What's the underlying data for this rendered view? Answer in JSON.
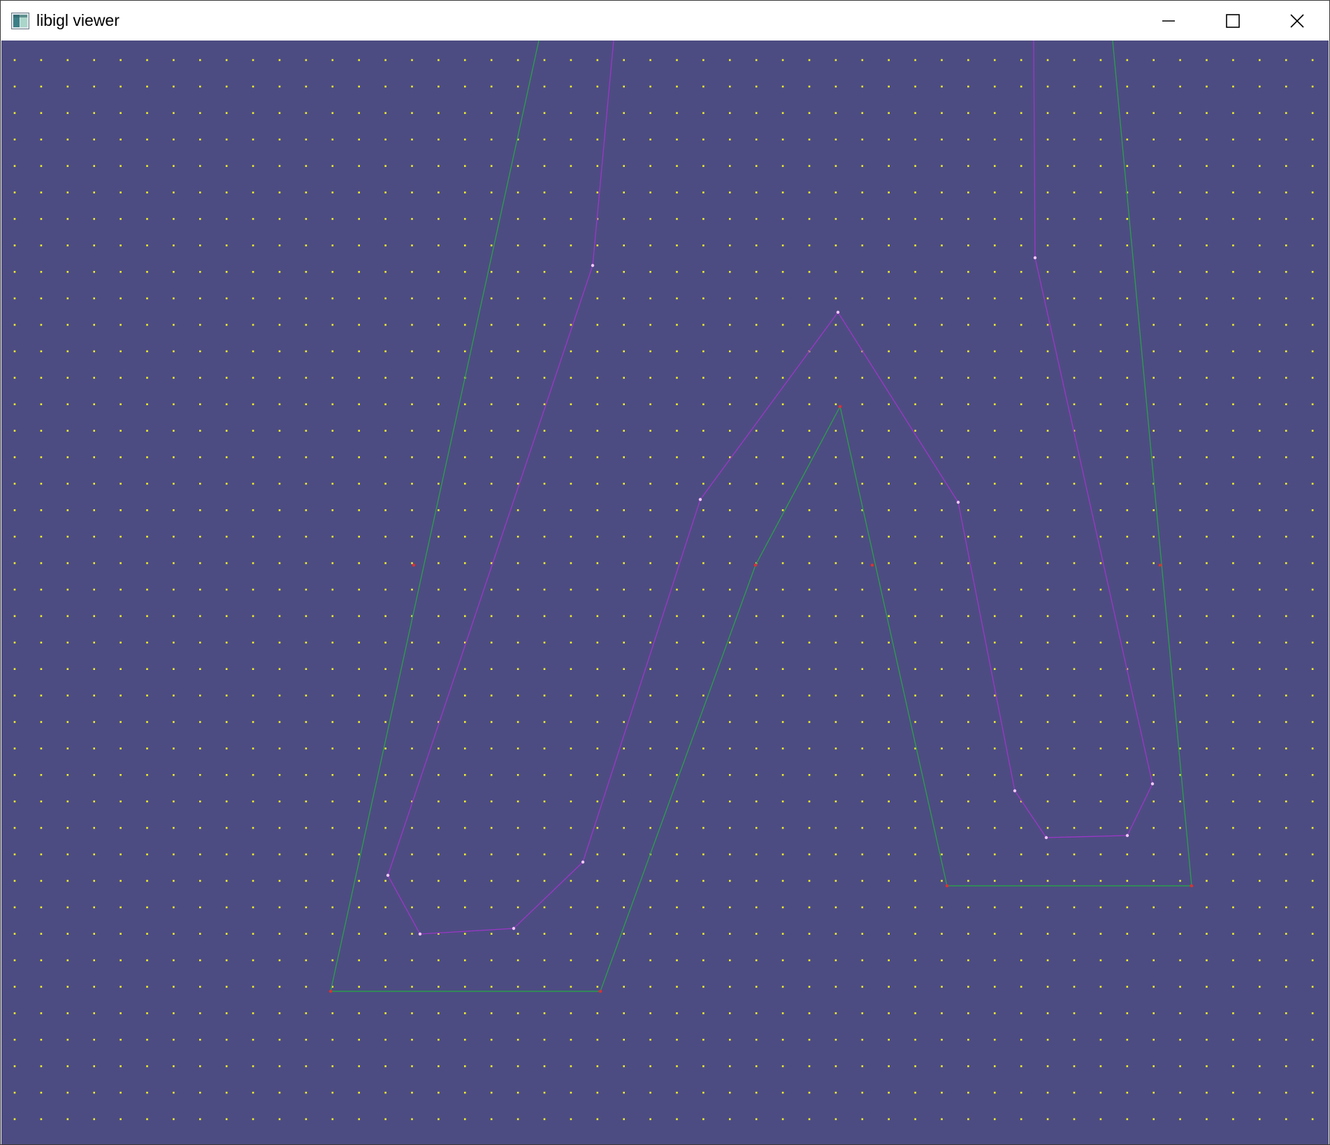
{
  "window": {
    "title": "libigl viewer",
    "app_icon": "libigl-app-icon",
    "controls": {
      "minimize": "minimize-icon",
      "maximize": "maximize-icon",
      "close": "close-icon"
    }
  },
  "viewport": {
    "background_color": "#4d4c82",
    "grid_point_color": "#f0f02a",
    "outer_polygon_color": "#29a04a",
    "offset_polygon_color": "#9c37c8",
    "offset_vertex_color": "#f4c6ff",
    "boundary_vertex_color": "#e03030"
  }
}
